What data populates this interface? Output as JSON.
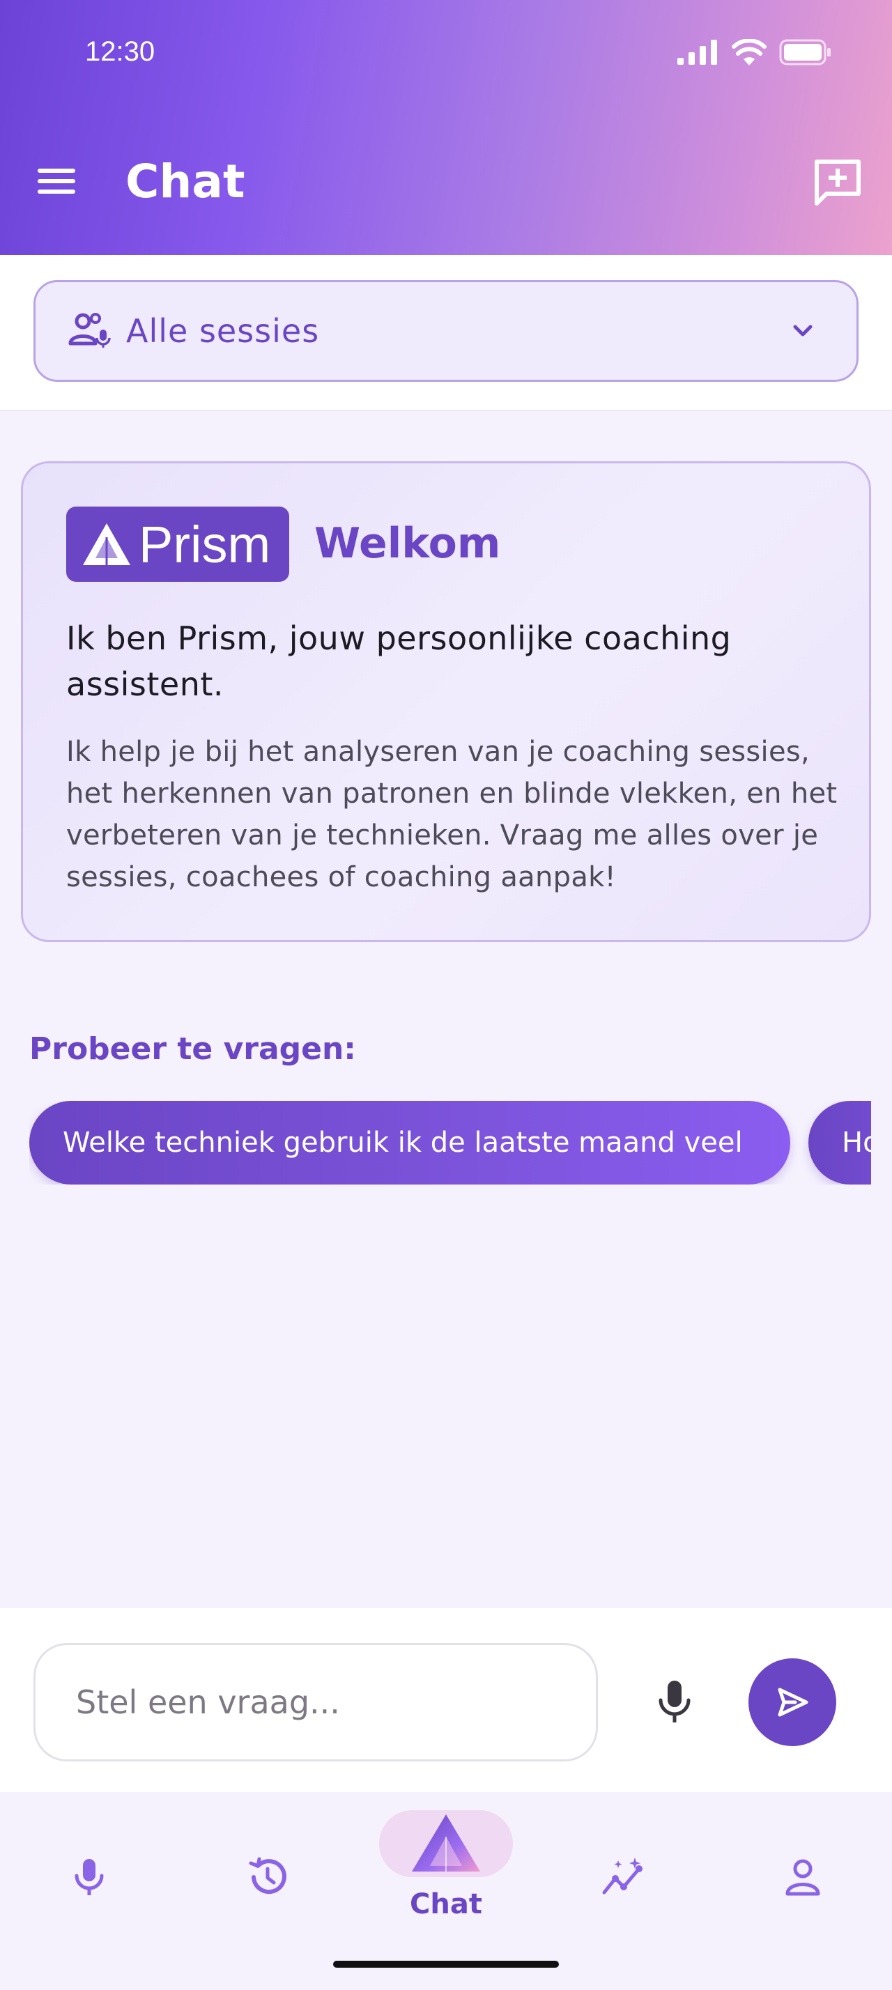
{
  "status_bar": {
    "time": "12:30",
    "icons": [
      "signal-icon",
      "wifi-icon",
      "battery-icon"
    ]
  },
  "header": {
    "title": "Chat",
    "menu_icon": "menu-icon",
    "action_icon": "new-chat-icon"
  },
  "filter": {
    "label": "Alle sessies",
    "icon": "people-mic-icon",
    "chevron": "chevron-down-icon"
  },
  "welcome": {
    "brand": "Prism",
    "heading": "Welkom",
    "intro": "Ik ben Prism, jouw persoonlijke coaching assistent.",
    "body": "Ik help je bij het analyseren van je coaching sessies, het herkennen van patronen en blinde vlekken, en het verbeteren van je technieken. Vraag me alles over je sessies, coachees of coaching aanpak!"
  },
  "suggestions": {
    "title": "Probeer te vragen:",
    "items": [
      "Welke techniek gebruik ik de laatste maand veel",
      "Ho"
    ]
  },
  "composer": {
    "placeholder": "Stel een vraag...",
    "mic_icon": "microphone-icon",
    "send_icon": "send-icon"
  },
  "bottom_nav": {
    "items": [
      {
        "icon": "microphone-icon",
        "label": ""
      },
      {
        "icon": "history-icon",
        "label": ""
      },
      {
        "icon": "prism-logo-icon",
        "label": "Chat",
        "active": true
      },
      {
        "icon": "insights-icon",
        "label": ""
      },
      {
        "icon": "profile-icon",
        "label": ""
      }
    ]
  },
  "colors": {
    "accent": "#6a45c4",
    "header_gradient_start": "#6c42d6",
    "header_gradient_end": "#eca2cd",
    "background": "#f5f2fd"
  }
}
